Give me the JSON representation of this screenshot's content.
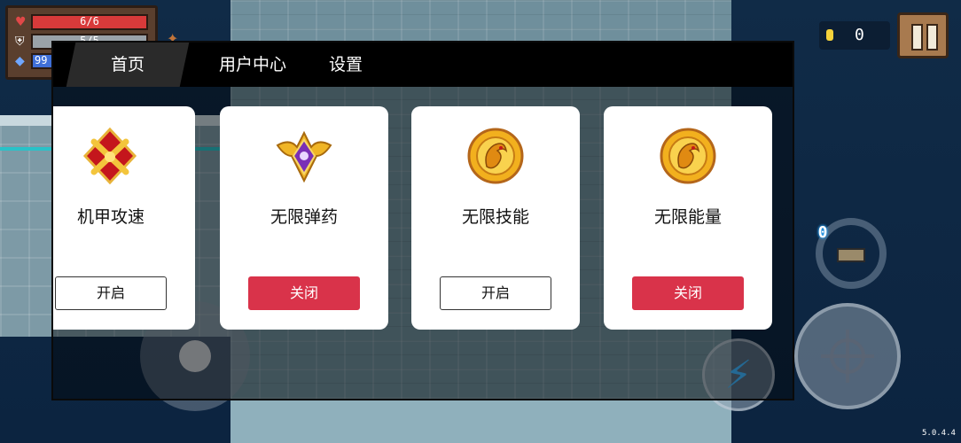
{
  "hud": {
    "hp": "6/6",
    "armor": "5/5",
    "energy": "99",
    "coins": "0",
    "weapon_energy_cost": "0"
  },
  "version": "5.0.4.4",
  "menu": {
    "tabs": [
      {
        "label": "首页",
        "active": true
      },
      {
        "label": "用户中心",
        "active": false
      },
      {
        "label": "设置",
        "active": false
      }
    ]
  },
  "cards": [
    {
      "title": "机甲攻速",
      "button": "开启",
      "state": "on",
      "icon": "crossed-swords-badge-icon"
    },
    {
      "title": "无限弹药",
      "button": "关闭",
      "state": "off",
      "icon": "purple-winged-badge-icon"
    },
    {
      "title": "无限技能",
      "button": "开启",
      "state": "on",
      "icon": "gold-dragon-badge-icon"
    },
    {
      "title": "无限能量",
      "button": "关闭",
      "state": "off",
      "icon": "gold-dragon-badge-icon"
    }
  ],
  "colors": {
    "toggle_off_bg": "#d9334a",
    "toggle_on_bg": "#ffffff",
    "tab_bar_bg": "#000000"
  }
}
